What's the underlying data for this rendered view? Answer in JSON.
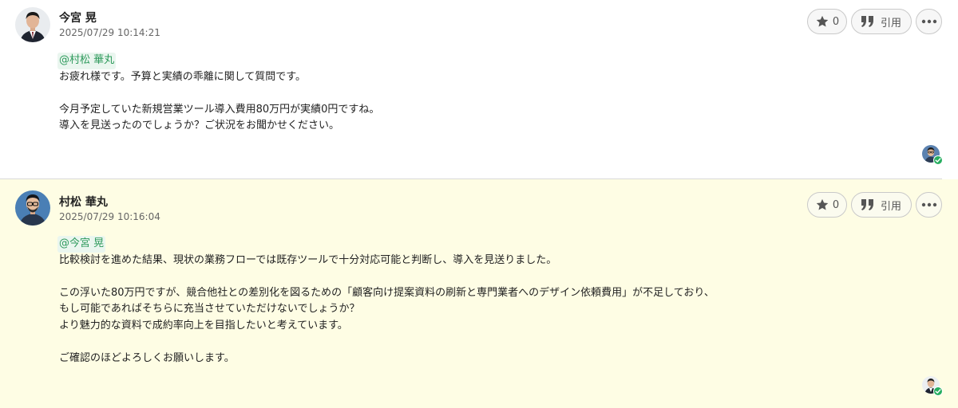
{
  "posts": [
    {
      "author": "今宮 晃",
      "timestamp": "2025/07/29 10:14:21",
      "mention": "@村松 華丸",
      "lines": [
        "お疲れ様です。予算と実績の乖離に関して質問です。",
        "",
        "今月予定していた新規営業ツール導入費用80万円が実績0円ですね。",
        "導入を見送ったのでしょうか？ご状況をお聞かせください。"
      ],
      "star_count": "0",
      "quote_label": "引用"
    },
    {
      "author": "村松 華丸",
      "timestamp": "2025/07/29 10:16:04",
      "mention": "@今宮 晃",
      "lines": [
        "比較検討を進めた結果、現状の業務フローでは既存ツールで十分対応可能と判断し、導入を見送りました。",
        "",
        "この浮いた80万円ですが、競合他社との差別化を図るための「顧客向け提案資料の刷新と専門業者へのデザイン依頼費用」が不足しており、",
        "もし可能であればそちらに充当させていただけないでしょうか？",
        "より魅力的な資料で成約率向上を目指したいと考えています。",
        "",
        "ご確認のほどよろしくお願いします。"
      ],
      "star_count": "0",
      "quote_label": "引用"
    }
  ],
  "icons": {
    "star": "star-icon",
    "quote": "quote-icon",
    "more": "more-icon",
    "read_check": "check-icon"
  },
  "colors": {
    "reply_background": "#fefde4",
    "mention_text": "#2e9a5c",
    "read_badge": "#27ae60"
  }
}
